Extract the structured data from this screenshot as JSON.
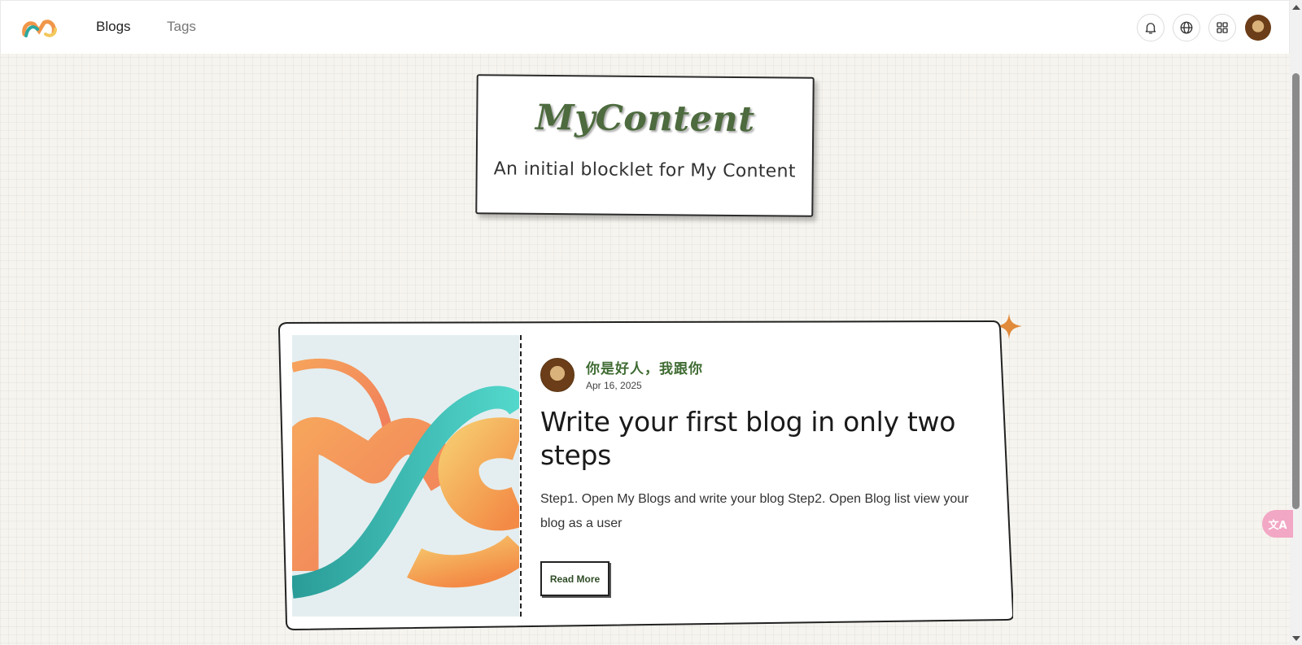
{
  "header": {
    "logo_text": "MC",
    "nav": [
      {
        "label": "Blogs"
      },
      {
        "label": "Tags"
      }
    ],
    "icons": [
      "bell-icon",
      "globe-icon",
      "apps-grid-icon",
      "user-avatar"
    ]
  },
  "hero": {
    "title": "MyContent",
    "subtitle": "An initial blocklet for My Content"
  },
  "post": {
    "author": "你是好人，我跟你",
    "date": "Apr 16, 2025",
    "title": "Write your first blog in only two steps",
    "excerpt": "Step1. Open My Blogs and write your blog Step2. Open Blog list view your blog as a user",
    "read_more": "Read More",
    "cover_text": "MC"
  },
  "colors": {
    "accent_green": "#3f6b32",
    "sparkle_orange": "#e08a3a",
    "translate_pink": "#f2a7c4"
  },
  "floating": {
    "translate_label": "文A"
  }
}
